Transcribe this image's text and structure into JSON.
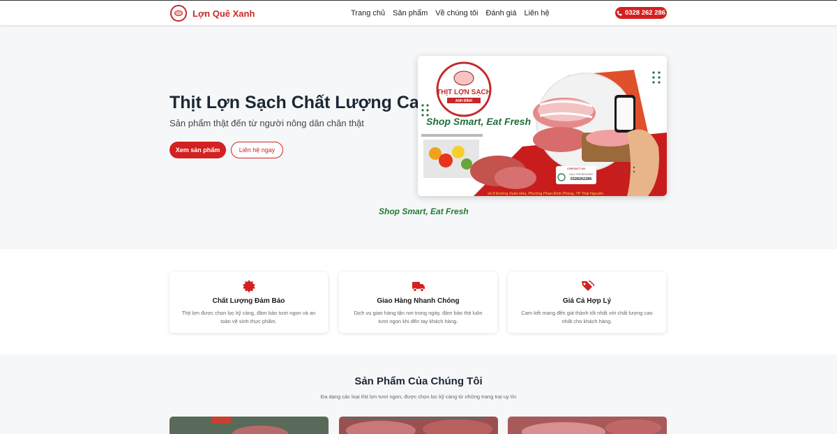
{
  "header": {
    "brand_name": "Lợn Quê Xanh",
    "nav": [
      "Trang chủ",
      "Sản phẩm",
      "Về chúng tôi",
      "Đánh giá",
      "Liên hệ"
    ],
    "phone": "0328 262 286"
  },
  "hero": {
    "title": "Thịt Lợn Sạch Chất Lượng Cao",
    "subtitle": "Sản phẩm thật đến từ người nông dân chân thật",
    "primary_button": "Xem sản phẩm",
    "secondary_button": "Liên hệ ngay",
    "tagline": "Shop Smart, Eat Fresh",
    "image": {
      "logo_title": "THỊT LỢN SẠCH",
      "logo_sub": "ANH BÌNH",
      "slogan": "Shop Smart, Eat Fresh",
      "contact_label": "CONTACT US",
      "booking_label": "CALL FOR BOOKING",
      "phone": "0328262286",
      "address": "số 8 Đường Xuân Hòa, Phường Phan Đình Phùng, TP Thái Nguyên"
    }
  },
  "features": [
    {
      "icon": "badge-icon",
      "title": "Chất Lượng Đảm Bảo",
      "text": "Thịt lợn được chọn lọc kỹ càng, đảm bảo tươi ngon và an toàn vệ sinh thực phẩm."
    },
    {
      "icon": "truck-icon",
      "title": "Giao Hàng Nhanh Chóng",
      "text": "Dịch vụ giao hàng tận nơi trong ngày, đảm bảo thịt luôn tươi ngon khi đến tay khách hàng."
    },
    {
      "icon": "tags-icon",
      "title": "Giá Cả Hợp Lý",
      "text": "Cam kết mang đến giá thành tốt nhất với chất lượng cao nhất cho khách hàng."
    }
  ],
  "products": {
    "title": "Sản Phẩm Của Chúng Tôi",
    "subtitle": "Đa dạng các loại thịt lợn tươi ngon, được chọn lọc kỹ càng từ những trang trại uy tín"
  },
  "colors": {
    "accent": "#d32020",
    "green": "#1f7a35",
    "dark": "#1d2735"
  }
}
